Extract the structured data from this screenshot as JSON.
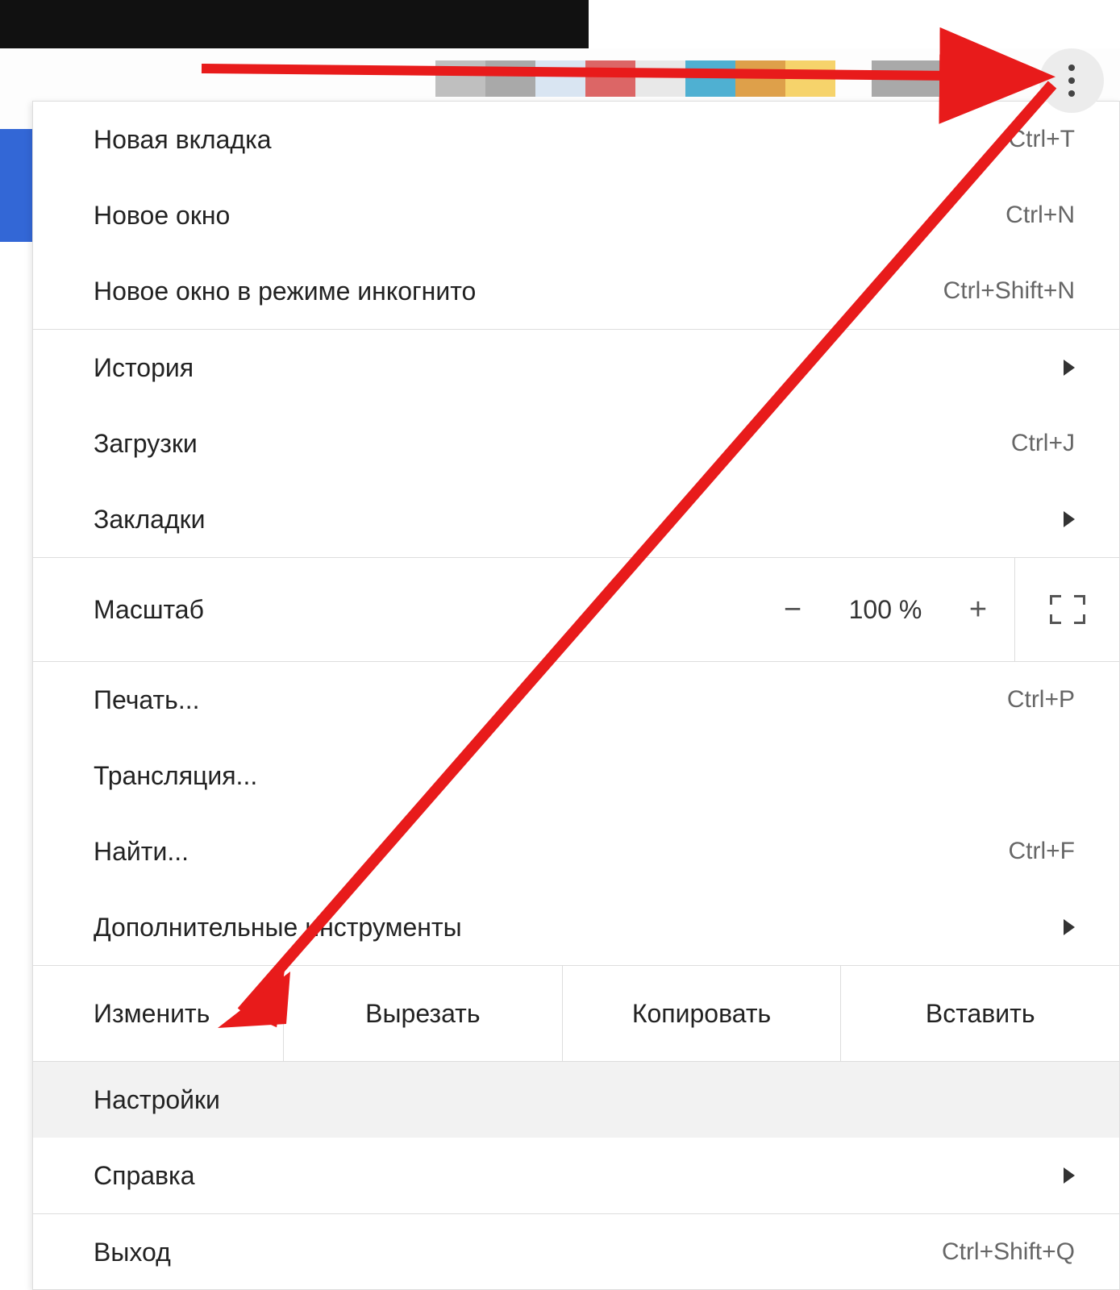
{
  "menu": {
    "new_tab": {
      "label": "Новая вкладка",
      "shortcut": "Ctrl+T"
    },
    "new_window": {
      "label": "Новое окно",
      "shortcut": "Ctrl+N"
    },
    "incognito": {
      "label": "Новое окно в режиме инкогнито",
      "shortcut": "Ctrl+Shift+N"
    },
    "history": {
      "label": "История"
    },
    "downloads": {
      "label": "Загрузки",
      "shortcut": "Ctrl+J"
    },
    "bookmarks": {
      "label": "Закладки"
    },
    "zoom": {
      "label": "Масштаб",
      "value": "100 %",
      "minus": "−",
      "plus": "+"
    },
    "print": {
      "label": "Печать...",
      "shortcut": "Ctrl+P"
    },
    "cast": {
      "label": "Трансляция..."
    },
    "find": {
      "label": "Найти...",
      "shortcut": "Ctrl+F"
    },
    "more_tools": {
      "label": "Дополнительные инструменты"
    },
    "edit": {
      "label": "Изменить",
      "cut": "Вырезать",
      "copy": "Копировать",
      "paste": "Вставить"
    },
    "settings": {
      "label": "Настройки"
    },
    "help": {
      "label": "Справка"
    },
    "exit": {
      "label": "Выход",
      "shortcut": "Ctrl+Shift+Q"
    }
  }
}
